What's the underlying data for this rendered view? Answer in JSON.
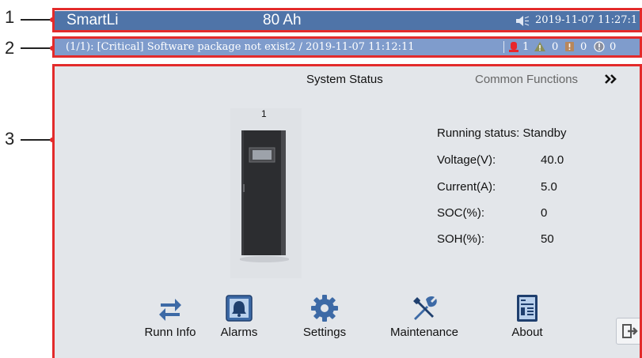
{
  "callouts": [
    "1",
    "2",
    "3"
  ],
  "header": {
    "app_name": "SmartLi",
    "capacity": "80 Ah",
    "datetime": "2019-11-07 11:27:1"
  },
  "alarm_bar": {
    "message": "(1/1): [Critical] Software package not exist2 / 2019-11-07 11:12:11",
    "counts": {
      "critical": "1",
      "major": "0",
      "minor": "0",
      "warning": "0"
    }
  },
  "main": {
    "title": "System Status",
    "common_functions": "Common Functions",
    "cabinet_id": "1",
    "status": [
      {
        "label": "Running status: Standby",
        "value": ""
      },
      {
        "label": "Voltage(V):",
        "value": "40.0"
      },
      {
        "label": "Current(A):",
        "value": "5.0"
      },
      {
        "label": "SOC(%):",
        "value": "0"
      },
      {
        "label": "SOH(%):",
        "value": "50"
      }
    ],
    "nav": [
      {
        "label": "Runn Info",
        "icon": "arrows-exchange-icon"
      },
      {
        "label": "Alarms",
        "icon": "bell-icon"
      },
      {
        "label": "Settings",
        "icon": "gear-icon"
      },
      {
        "label": "Maintenance",
        "icon": "tools-icon"
      },
      {
        "label": "About",
        "icon": "about-document-icon"
      }
    ]
  },
  "colors": {
    "header_bg": "#4f74a8",
    "alarm_bg": "#7f9ccc",
    "main_bg": "#e3e6ea",
    "highlight": "#e32b2b",
    "icon_blue": "#3d6aa6"
  }
}
